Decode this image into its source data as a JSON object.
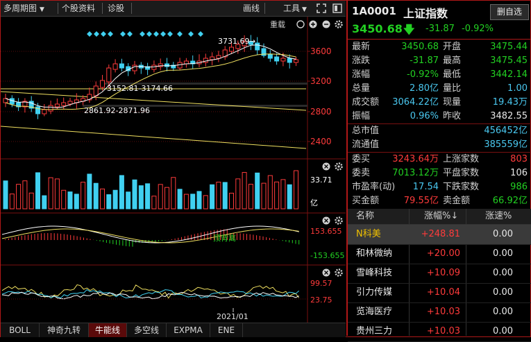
{
  "toolbar": {
    "period": "多周期图",
    "menu_caret": "▼",
    "stock_info": "个股资料",
    "diagnose": "诊股",
    "draw": "画线",
    "tools": "工具",
    "tools_caret": "▼"
  },
  "chart": {
    "overlay_label": "重载",
    "arrow_label": "→",
    "price_axis": [
      "3600",
      "3200",
      "2800",
      "2400"
    ],
    "peak_label": "3731.69",
    "band_upper": "3152.81-3174.66",
    "band_lower": "2861.92-2871.96",
    "volume_axis": [
      "33.71",
      "亿"
    ],
    "macd_axis": [
      "153.655",
      "-153.655"
    ],
    "macd_annotation": "顶背离",
    "osc_axis": [
      "99.57",
      "23.75"
    ],
    "date_label": "2021/01",
    "colors": {
      "up": "#ff3b3b",
      "down": "#40d0f0",
      "ma1": "#ffffff",
      "ma2": "#f0e060",
      "diamond": "#40d0f0"
    }
  },
  "bottom_tabs": [
    "BOLL",
    "神奇九转",
    "牛能线",
    "多空线",
    "EXPMA",
    "ENE"
  ],
  "active_tab": "牛能线",
  "quote": {
    "code": "1A0001",
    "name": "上证指数",
    "delete_btn": "删自选",
    "price": "3450.68",
    "arrow": "🡇",
    "change": "-31.87",
    "change_pct": "-0.92%",
    "rows": [
      {
        "l1": "最新",
        "v1": "3450.68",
        "c1": "g",
        "l2": "开盘",
        "v2": "3475.44",
        "c2": "g"
      },
      {
        "l1": "涨跌",
        "v1": "-31.87",
        "c1": "g",
        "l2": "最高",
        "v2": "3475.45",
        "c2": "g"
      },
      {
        "l1": "涨幅",
        "v1": "-0.92%",
        "c1": "g",
        "l2": "最低",
        "v2": "3442.14",
        "c2": "g"
      },
      {
        "l1": "总量",
        "v1": "2.80亿",
        "c1": "c",
        "l2": "量比",
        "v2": "1.00",
        "c2": "c"
      },
      {
        "l1": "成交额",
        "v1": "3064.22亿",
        "c1": "c",
        "l2": "现量",
        "v2": "19.43万",
        "c2": "c"
      },
      {
        "l1": "振幅",
        "v1": "0.96%",
        "c1": "c",
        "l2": "昨收",
        "v2": "3482.55",
        "c2": "w"
      }
    ],
    "rows_b": [
      {
        "l1": "总市值",
        "v1": "456452亿",
        "c1": "c"
      },
      {
        "l1": "流通值",
        "v1": "385559亿",
        "c1": "c"
      }
    ],
    "rows_c": [
      {
        "l1": "委买",
        "v1": "3243.64万",
        "c1": "r",
        "l2": "上涨家数",
        "v2": "803",
        "c2": "r"
      },
      {
        "l1": "委卖",
        "v1": "7013.12万",
        "c1": "g",
        "l2": "平盘家数",
        "v2": "106",
        "c2": "w"
      },
      {
        "l1": "市盈率(动)",
        "v1": "17.54",
        "c1": "c",
        "l2": "下跌家数",
        "v2": "986",
        "c2": "g"
      },
      {
        "l1": "买金额",
        "v1": "79.55亿",
        "c1": "r",
        "l2": "卖金额",
        "v2": "66.92亿",
        "c2": "g"
      }
    ]
  },
  "list": {
    "headers": [
      "名称",
      "涨幅%↓",
      "涨速%"
    ],
    "rows": [
      {
        "name": "N科美",
        "pct": "+248.81",
        "speed": "0.00"
      },
      {
        "name": "和林微纳",
        "pct": "+20.00",
        "speed": "0.00"
      },
      {
        "name": "雪峰科技",
        "pct": "+10.09",
        "speed": "0.00"
      },
      {
        "name": "引力传媒",
        "pct": "+10.04",
        "speed": "0.00"
      },
      {
        "name": "览海医疗",
        "pct": "+10.03",
        "speed": "0.00"
      },
      {
        "name": "贵州三力",
        "pct": "+10.03",
        "speed": "0.00"
      }
    ]
  }
}
